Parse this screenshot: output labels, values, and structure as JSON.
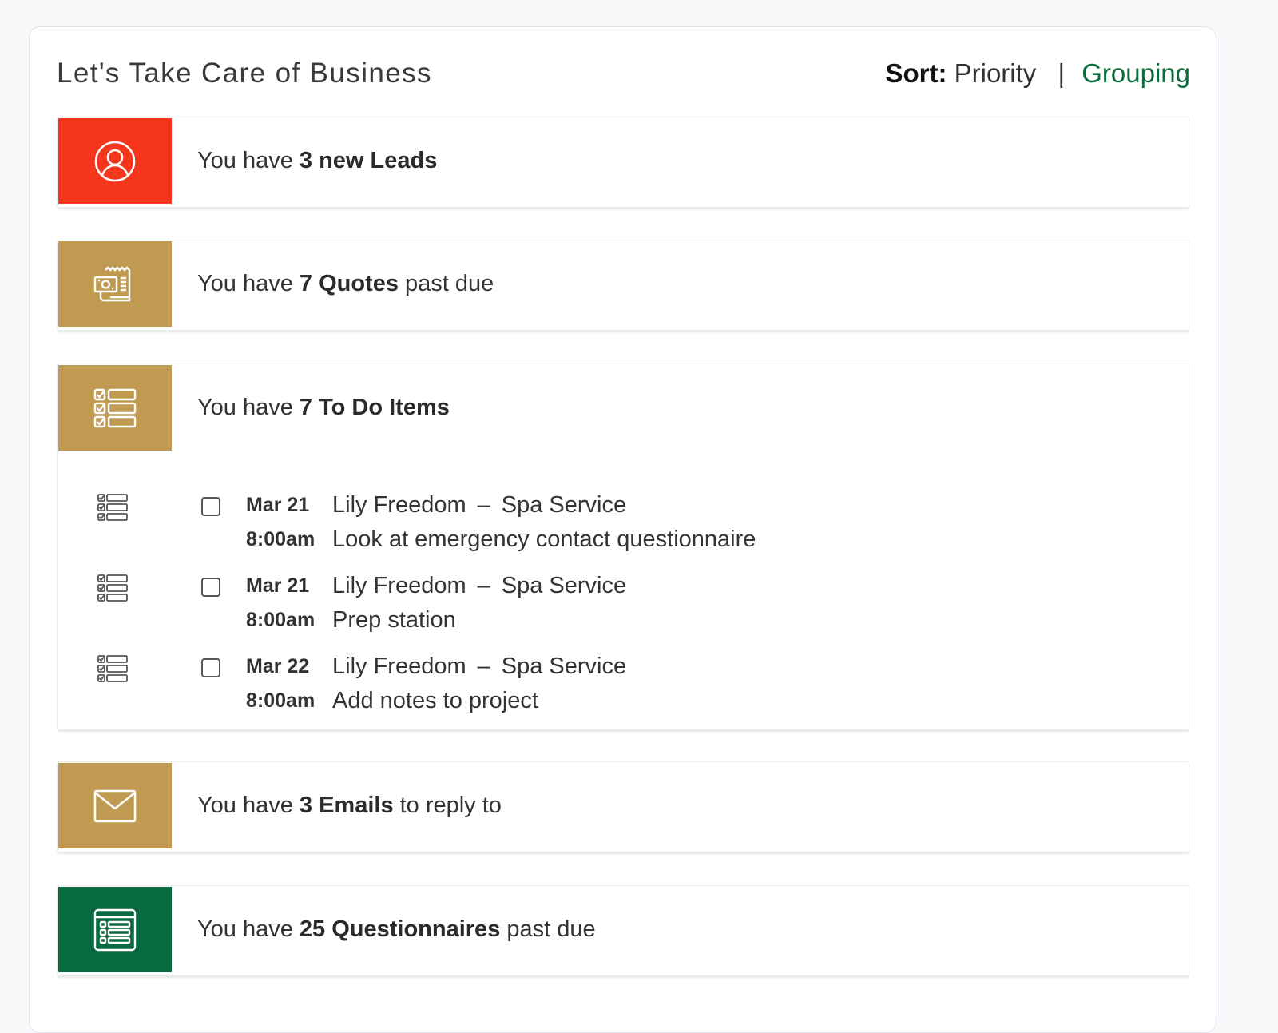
{
  "panel": {
    "title": "Let's Take Care of Business",
    "sort_label": "Sort:",
    "sort_value": "Priority",
    "separator": "|",
    "grouping_label": "Grouping"
  },
  "colors": {
    "red": "#f5361c",
    "gold": "#c19a52",
    "green": "#086a3f",
    "grouping_link": "#0a6b3b"
  },
  "cards": [
    {
      "icon": "person-icon",
      "color": "red",
      "prefix": "You have",
      "highlight": "3 new Leads",
      "suffix": ""
    },
    {
      "icon": "quote-receipt-icon",
      "color": "gold",
      "prefix": "You have",
      "highlight": "7 Quotes",
      "suffix": "past due"
    },
    {
      "icon": "checklist-icon",
      "color": "gold",
      "prefix": "You have",
      "highlight": "7 To Do Items",
      "suffix": ""
    },
    {
      "icon": "envelope-icon",
      "color": "gold",
      "prefix": "You have",
      "highlight": "3 Emails",
      "suffix": "to reply to"
    },
    {
      "icon": "questionnaire-icon",
      "color": "green",
      "prefix": "You have",
      "highlight": "25 Questionnaires",
      "suffix": "past due"
    }
  ],
  "todos": [
    {
      "date": "Mar 21",
      "time": "8:00am",
      "client": "Lily Freedom",
      "dash": "–",
      "project": "Spa Service",
      "task": "Look at emergency contact questionnaire",
      "checked": false
    },
    {
      "date": "Mar 21",
      "time": "8:00am",
      "client": "Lily Freedom",
      "dash": "–",
      "project": "Spa Service",
      "task": "Prep station",
      "checked": false
    },
    {
      "date": "Mar 22",
      "time": "8:00am",
      "client": "Lily Freedom",
      "dash": "–",
      "project": "Spa Service",
      "task": "Add notes to project",
      "checked": false
    }
  ]
}
